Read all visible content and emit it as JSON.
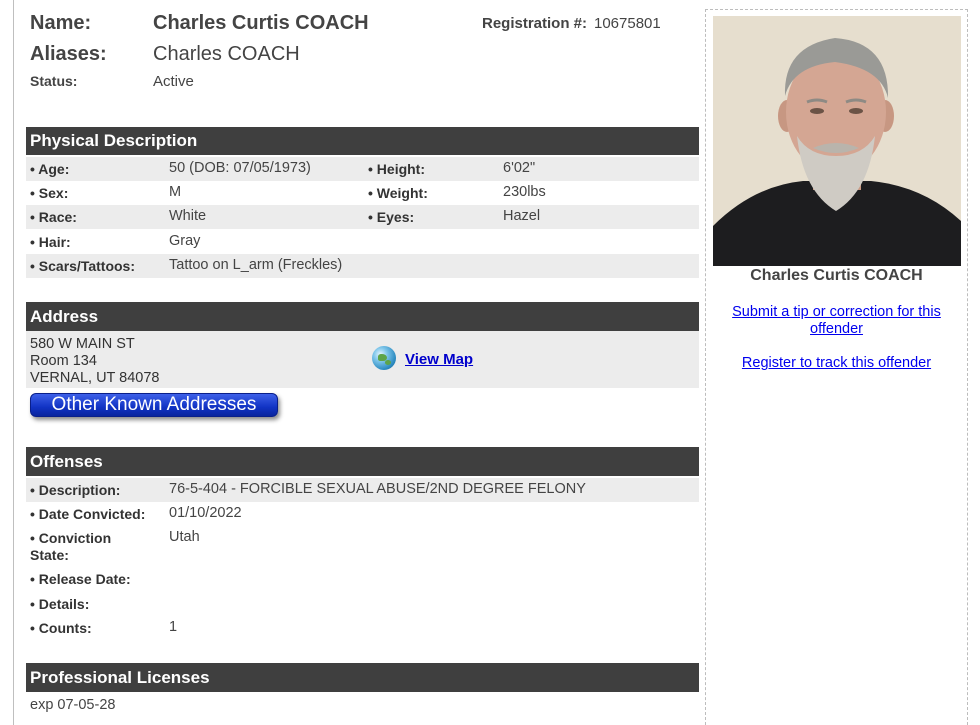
{
  "header": {
    "name_label": "Name:",
    "name_value": "Charles Curtis COACH",
    "aliases_label": "Aliases:",
    "aliases_value": "Charles COACH",
    "status_label": "Status:",
    "status_value": "Active",
    "registration_label": "Registration #:",
    "registration_value": "10675801"
  },
  "physical": {
    "title": "Physical Description",
    "age_label": "• Age:",
    "age_value": "50  (DOB: 07/05/1973)",
    "height_label": "• Height:",
    "height_value": "6'02\"",
    "sex_label": "• Sex:",
    "sex_value": "M",
    "weight_label": "• Weight:",
    "weight_value": "230lbs",
    "race_label": "• Race:",
    "race_value": "White",
    "eyes_label": "• Eyes:",
    "eyes_value": "Hazel",
    "hair_label": "• Hair:",
    "hair_value": "Gray",
    "scars_label": "• Scars/Tattoos:",
    "scars_value": "Tattoo on L_arm (Freckles)"
  },
  "address": {
    "title": "Address",
    "line1": "580 W MAIN ST",
    "line2": "Room 134",
    "line3": "VERNAL, UT 84078",
    "view_map": "View Map",
    "other_button": "Other Known Addresses"
  },
  "offenses": {
    "title": "Offenses",
    "description_label": "• Description:",
    "description_value": "76-5-404 - FORCIBLE SEXUAL ABUSE/2ND DEGREE FELONY",
    "date_label": "• Date Convicted:",
    "date_value": "01/10/2022",
    "state_label_1": "• Conviction",
    "state_label_2": "State:",
    "state_value": "Utah",
    "release_label": "• Release Date:",
    "details_label": "• Details:",
    "counts_label": "• Counts:",
    "counts_value": "1"
  },
  "licenses": {
    "title": "Professional Licenses",
    "text": "exp 07-05-28"
  },
  "sidebar": {
    "photo_icon": "offender-photo",
    "name": "Charles Curtis COACH",
    "tip_link_1": "Submit a tip or correction for this",
    "tip_link_2": "offender",
    "register_link": "Register to track this offender"
  },
  "colors": {
    "section_header_bg": "#3f3f3f",
    "row_shade": "#ececec",
    "link": "#0000ee",
    "button": "#1133c4"
  }
}
